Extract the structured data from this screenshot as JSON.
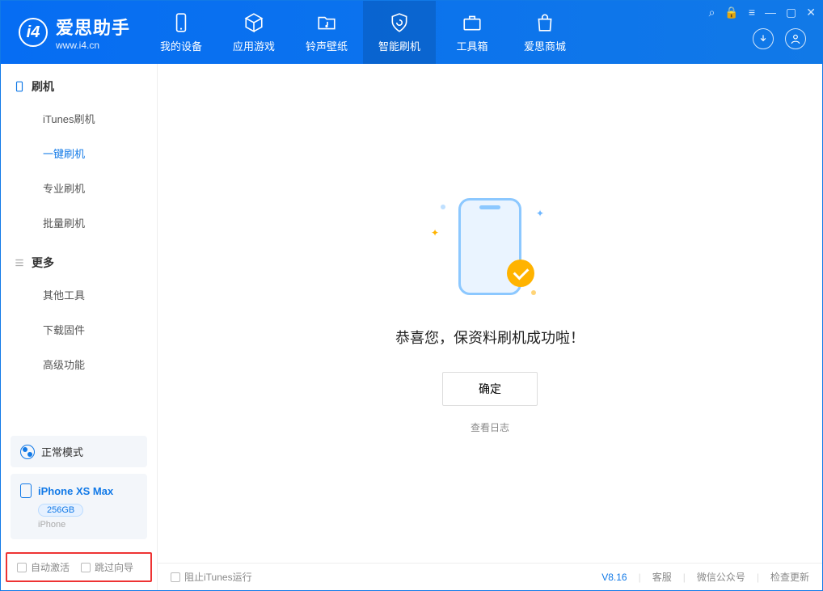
{
  "app": {
    "name": "爱思助手",
    "site": "www.i4.cn"
  },
  "tabs": {
    "device": "我的设备",
    "apps": "应用游戏",
    "ringtone": "铃声壁纸",
    "flash": "智能刷机",
    "toolbox": "工具箱",
    "store": "爱思商城"
  },
  "sidebar": {
    "section_flash": "刷机",
    "items_flash": {
      "itunes": "iTunes刷机",
      "oneclick": "一键刷机",
      "pro": "专业刷机",
      "batch": "批量刷机"
    },
    "section_more": "更多",
    "items_more": {
      "other": "其他工具",
      "firmware": "下载固件",
      "advanced": "高级功能"
    },
    "mode": "正常模式",
    "device_name": "iPhone XS Max",
    "capacity": "256GB",
    "device_type": "iPhone",
    "chk_auto_activate": "自动激活",
    "chk_skip_guide": "跳过向导"
  },
  "main": {
    "success_text": "恭喜您，保资料刷机成功啦！",
    "ok": "确定",
    "view_log": "查看日志"
  },
  "footer": {
    "block_itunes": "阻止iTunes运行",
    "version": "V8.16",
    "support": "客服",
    "wechat": "微信公众号",
    "update": "检查更新"
  }
}
